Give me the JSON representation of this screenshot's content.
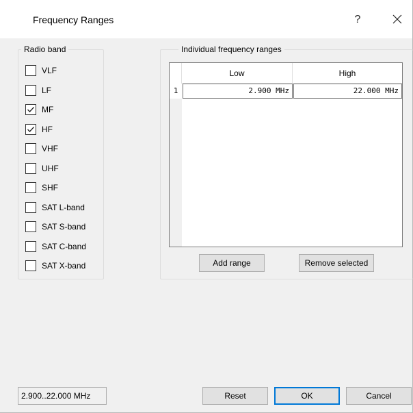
{
  "window": {
    "title": "Frequency Ranges",
    "help_label": "?"
  },
  "radio_band": {
    "title": "Radio band",
    "items": [
      {
        "label": "VLF",
        "checked": false
      },
      {
        "label": "LF",
        "checked": false
      },
      {
        "label": "MF",
        "checked": true
      },
      {
        "label": "HF",
        "checked": true
      },
      {
        "label": "VHF",
        "checked": false
      },
      {
        "label": "UHF",
        "checked": false
      },
      {
        "label": "SHF",
        "checked": false
      },
      {
        "label": "SAT L-band",
        "checked": false
      },
      {
        "label": "SAT S-band",
        "checked": false
      },
      {
        "label": "SAT C-band",
        "checked": false
      },
      {
        "label": "SAT X-band",
        "checked": false
      }
    ]
  },
  "ranges": {
    "title": "Individual frequency ranges",
    "columns": [
      "Low",
      "High"
    ],
    "rows": [
      {
        "index": "1",
        "low": "2.900 MHz",
        "high": "22.000 MHz"
      }
    ],
    "add_label": "Add range",
    "remove_label": "Remove selected"
  },
  "footer": {
    "summary": "2.900..22.000 MHz",
    "reset_label": "Reset",
    "ok_label": "OK",
    "cancel_label": "Cancel"
  },
  "colors": {
    "accent": "#0078d7",
    "dialog_bg": "#f0f0f0"
  }
}
